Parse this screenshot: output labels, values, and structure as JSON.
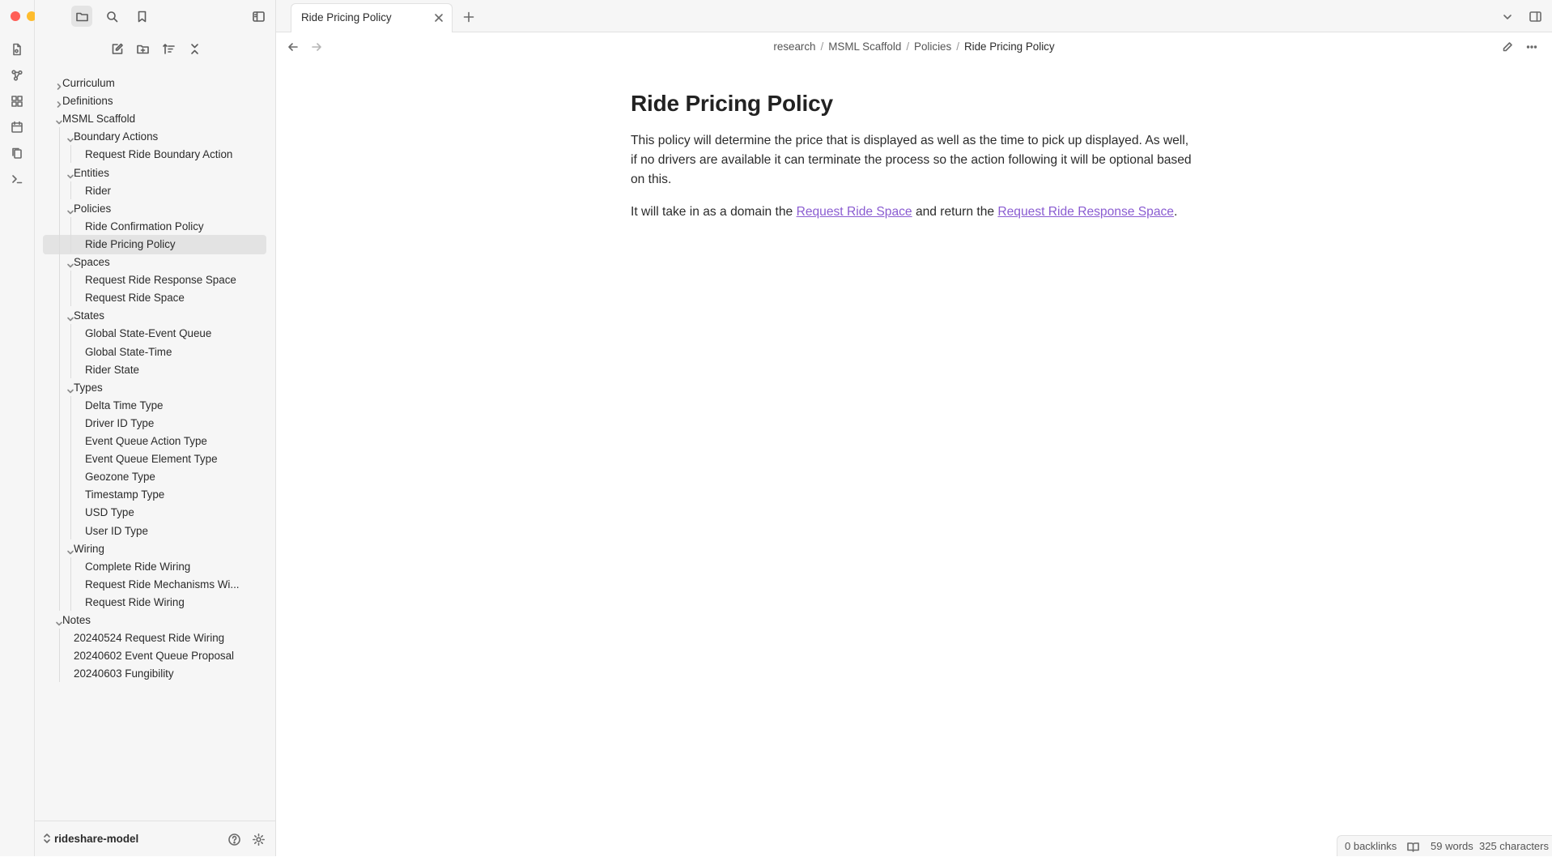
{
  "colors": {
    "close": "#ff5f57",
    "minimize": "#febc2e",
    "zoom": "#28c840",
    "link": "#8a5cd1"
  },
  "ribbon": {
    "icons": [
      "file-icon",
      "graph-icon",
      "canvas-icon",
      "calendar-icon",
      "copy-icon",
      "terminal-icon"
    ]
  },
  "sidebar": {
    "top_icons": [
      "folder-icon",
      "search-icon",
      "bookmark-icon"
    ],
    "toolbar_icons": [
      "new-note-icon",
      "new-folder-icon",
      "sort-icon",
      "collapse-all-icon"
    ],
    "tree": [
      {
        "label": "Curriculum",
        "level": 0,
        "type": "folder",
        "expanded": false
      },
      {
        "label": "Definitions",
        "level": 0,
        "type": "folder",
        "expanded": false
      },
      {
        "label": "MSML Scaffold",
        "level": 0,
        "type": "folder",
        "expanded": true
      },
      {
        "label": "Boundary Actions",
        "level": 1,
        "type": "folder",
        "expanded": true
      },
      {
        "label": "Request Ride Boundary Action",
        "level": 2,
        "type": "file"
      },
      {
        "label": "Entities",
        "level": 1,
        "type": "folder",
        "expanded": true
      },
      {
        "label": "Rider",
        "level": 2,
        "type": "file"
      },
      {
        "label": "Policies",
        "level": 1,
        "type": "folder",
        "expanded": true
      },
      {
        "label": "Ride Confirmation Policy",
        "level": 2,
        "type": "file"
      },
      {
        "label": "Ride Pricing Policy",
        "level": 2,
        "type": "file",
        "active": true
      },
      {
        "label": "Spaces",
        "level": 1,
        "type": "folder",
        "expanded": true
      },
      {
        "label": "Request Ride Response Space",
        "level": 2,
        "type": "file"
      },
      {
        "label": "Request Ride Space",
        "level": 2,
        "type": "file"
      },
      {
        "label": "States",
        "level": 1,
        "type": "folder",
        "expanded": true
      },
      {
        "label": "Global State-Event Queue",
        "level": 2,
        "type": "file"
      },
      {
        "label": "Global State-Time",
        "level": 2,
        "type": "file"
      },
      {
        "label": "Rider State",
        "level": 2,
        "type": "file"
      },
      {
        "label": "Types",
        "level": 1,
        "type": "folder",
        "expanded": true
      },
      {
        "label": "Delta Time Type",
        "level": 2,
        "type": "file"
      },
      {
        "label": "Driver ID Type",
        "level": 2,
        "type": "file"
      },
      {
        "label": "Event Queue Action Type",
        "level": 2,
        "type": "file"
      },
      {
        "label": "Event Queue Element Type",
        "level": 2,
        "type": "file"
      },
      {
        "label": "Geozone Type",
        "level": 2,
        "type": "file"
      },
      {
        "label": "Timestamp Type",
        "level": 2,
        "type": "file"
      },
      {
        "label": "USD Type",
        "level": 2,
        "type": "file"
      },
      {
        "label": "User ID Type",
        "level": 2,
        "type": "file"
      },
      {
        "label": "Wiring",
        "level": 1,
        "type": "folder",
        "expanded": true
      },
      {
        "label": "Complete Ride Wiring",
        "level": 2,
        "type": "file"
      },
      {
        "label": "Request Ride Mechanisms Wi...",
        "level": 2,
        "type": "file"
      },
      {
        "label": "Request Ride Wiring",
        "level": 2,
        "type": "file"
      },
      {
        "label": "Notes",
        "level": 0,
        "type": "folder",
        "expanded": true
      },
      {
        "label": "20240524 Request Ride Wiring",
        "level": 1,
        "type": "file"
      },
      {
        "label": "20240602 Event Queue Proposal",
        "level": 1,
        "type": "file"
      },
      {
        "label": "20240603 Fungibility",
        "level": 1,
        "type": "file"
      }
    ],
    "vault_name": "rideshare-model"
  },
  "tabs": {
    "active_label": "Ride Pricing Policy"
  },
  "breadcrumb": {
    "items": [
      "research",
      "MSML Scaffold",
      "Policies"
    ],
    "current": "Ride Pricing Policy",
    "separator": "/"
  },
  "document": {
    "title": "Ride Pricing Policy",
    "para1": "This policy will determine the price that is displayed as well as the time to pick up displayed. As well, if no drivers are available it can terminate the process so the action following it will be optional based on this.",
    "para2_before": "It will take in as a domain the ",
    "link1": "Request Ride Space",
    "para2_middle": " and return the ",
    "link2": "Request Ride Response Space",
    "para2_after": "."
  },
  "status": {
    "backlinks": "0 backlinks",
    "words": "59 words",
    "characters": "325 characters"
  }
}
